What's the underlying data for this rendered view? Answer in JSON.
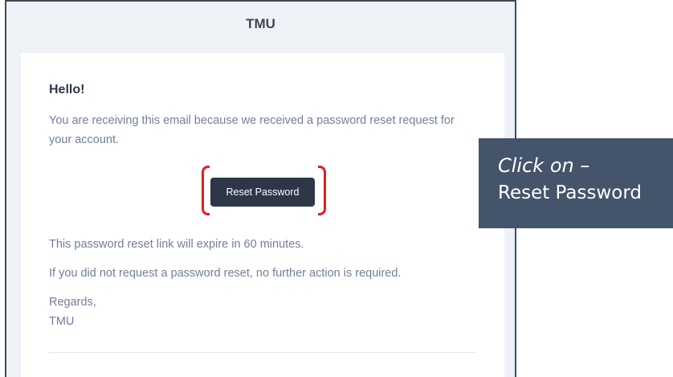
{
  "email": {
    "header_title": "TMU",
    "greeting": "Hello!",
    "intro": "You are receiving this email because we received a password reset request for your account.",
    "button_label": "Reset Password",
    "expiry_note": "This password reset link will expire in 60 minutes.",
    "no_action_note": "If you did not request a password reset, no further action is required.",
    "regards": "Regards,",
    "signature": "TMU"
  },
  "callout": {
    "line1": "Click on –",
    "line2": "Reset Password"
  },
  "colors": {
    "button": "#2d3748",
    "highlight": "#e02020",
    "callout_bg": "#44546a"
  }
}
